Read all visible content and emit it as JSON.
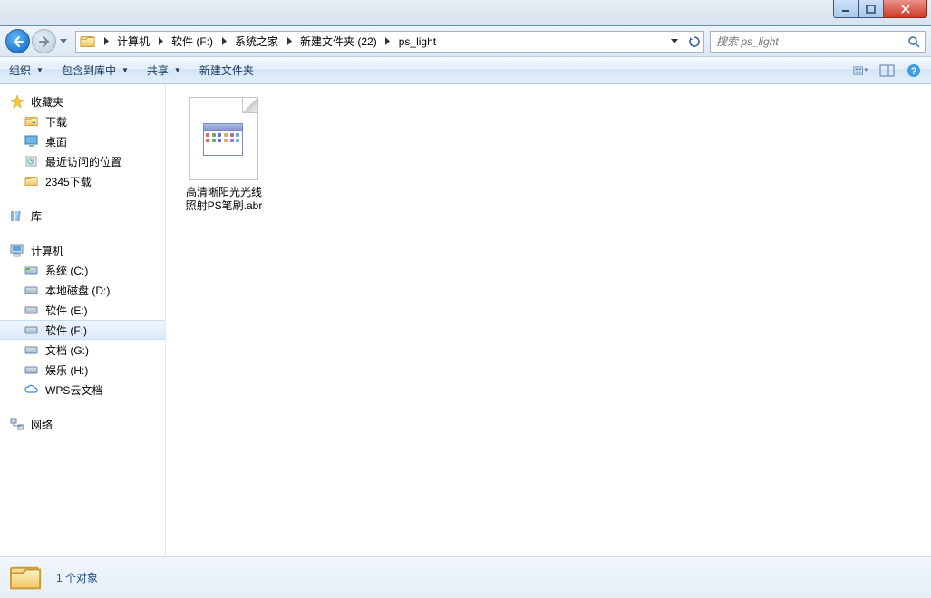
{
  "breadcrumb": {
    "items": [
      "计算机",
      "软件 (F:)",
      "系统之家",
      "新建文件夹 (22)",
      "ps_light"
    ]
  },
  "search": {
    "placeholder": "搜索 ps_light"
  },
  "toolbar": {
    "organize": "组织",
    "include": "包含到库中",
    "share": "共享",
    "newfolder": "新建文件夹"
  },
  "sidebar": {
    "favorites": {
      "label": "收藏夹",
      "items": [
        "下载",
        "桌面",
        "最近访问的位置",
        "2345下载"
      ]
    },
    "libraries": {
      "label": "库"
    },
    "computer": {
      "label": "计算机",
      "items": [
        "系统 (C:)",
        "本地磁盘 (D:)",
        "软件 (E:)",
        "软件 (F:)",
        "文档 (G:)",
        "娱乐 (H:)",
        "WPS云文档"
      ],
      "selected": 3
    },
    "network": {
      "label": "网络"
    }
  },
  "files": [
    {
      "name_l1": "高清晰阳光光线",
      "name_l2": "照射PS笔刷.abr"
    }
  ],
  "status": {
    "count": "1 个对象"
  }
}
